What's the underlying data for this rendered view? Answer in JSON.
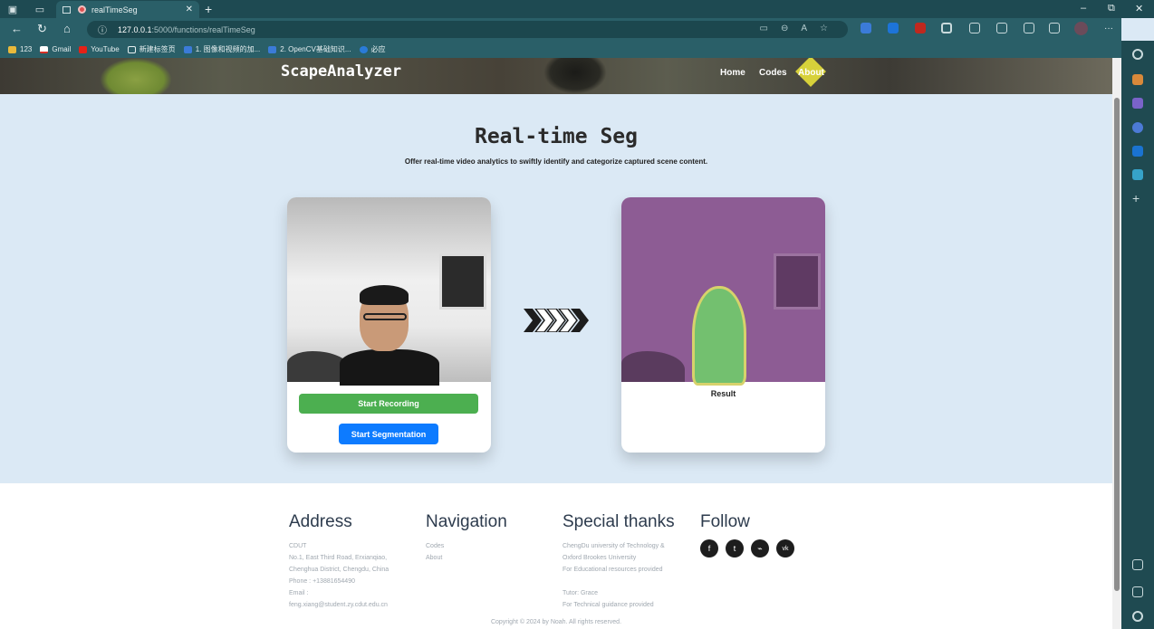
{
  "browser": {
    "tab_title": "realTimeSeg",
    "url_host": "127.0.0.1",
    "url_path": ":5000/functions/realTimeSeg",
    "bookmarks": [
      "123",
      "Gmail",
      "YouTube",
      "新建标签页",
      "1. 图像和视频的加...",
      "2. OpenCV基础知识...",
      "必应"
    ],
    "window_controls": [
      "–",
      "⧉",
      "✕"
    ]
  },
  "header": {
    "brand": "ScapeAnalyzer",
    "nav": [
      "Home",
      "Codes",
      "About"
    ]
  },
  "main": {
    "title": "Real-time Seg",
    "subtitle": "Offer real-time video analytics to swiftly identify and categorize captured scene content.",
    "record_button": "Start Recording",
    "segment_button": "Start Segmentation",
    "result_label": "Result"
  },
  "footer": {
    "address": {
      "heading": "Address",
      "lines": [
        "CDUT",
        "No.1, East Third Road, Erxianqiao,",
        "Chenghua District, Chengdu, China",
        "Phone : +13881654490",
        "Email :",
        "feng.xiang@student.zy.cdut.edu.cn"
      ]
    },
    "navigation": {
      "heading": "Navigation",
      "links": [
        "Codes",
        "About"
      ]
    },
    "thanks": {
      "heading": "Special thanks",
      "lines": [
        "ChengDu university of Technology &",
        "Oxford Brookes University",
        "For Educational resources provided",
        "",
        "Tutor: Grace",
        "For Technical guidance provided"
      ]
    },
    "follow": {
      "heading": "Follow",
      "icons": [
        "facebook-icon",
        "twitter-icon",
        "rss-icon",
        "vk-icon"
      ],
      "glyphs": [
        "f",
        "t",
        "⌁",
        "vk"
      ]
    },
    "copyright": "Copyright © 2024 by Noah. All rights reserved."
  },
  "colors": {
    "page_bg": "#dbe9f5",
    "record_green": "#4caf50",
    "segment_blue": "#0d7bff",
    "seg_purple": "#8d5c94",
    "seg_green": "#73c06f"
  }
}
